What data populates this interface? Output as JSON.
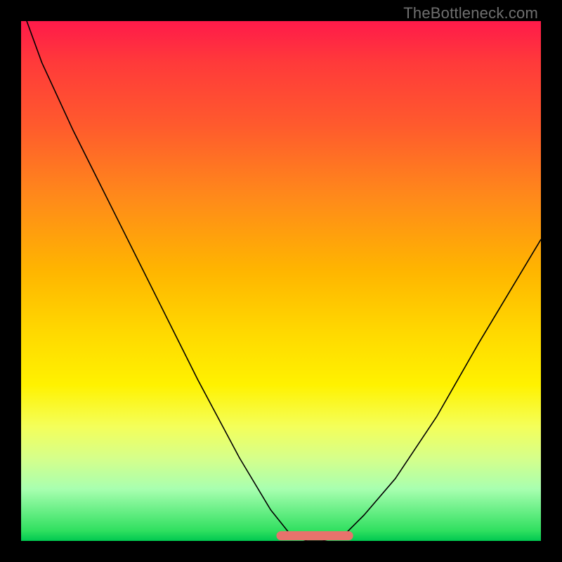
{
  "watermark": "TheBottleneck.com",
  "chart_data": {
    "type": "line",
    "title": "",
    "xlabel": "",
    "ylabel": "",
    "xlim": [
      0,
      100
    ],
    "ylim": [
      0,
      100
    ],
    "background_gradient": {
      "top_color": "#ff1a4a",
      "bottom_color": "#00c850",
      "note": "vertical gradient red→orange→yellow→green indicating bottleneck severity (top=worst, bottom=best)"
    },
    "series": [
      {
        "name": "bottleneck-curve",
        "note": "black V-shaped curve; y≈100 at x=0, y≈0 on flat span x≈52–62, rising to y≈58 at x=100",
        "x": [
          0,
          4,
          10,
          18,
          26,
          34,
          42,
          48,
          52,
          55,
          58,
          62,
          66,
          72,
          80,
          88,
          94,
          100
        ],
        "y": [
          103,
          92,
          79,
          63,
          47,
          31,
          16,
          6,
          1,
          0,
          0,
          1,
          5,
          12,
          24,
          38,
          48,
          58
        ]
      },
      {
        "name": "optimal-zone-marker",
        "note": "thick salmon/red segment highlighting the flat minimum",
        "x": [
          50,
          63
        ],
        "y": [
          1,
          1
        ]
      }
    ]
  }
}
